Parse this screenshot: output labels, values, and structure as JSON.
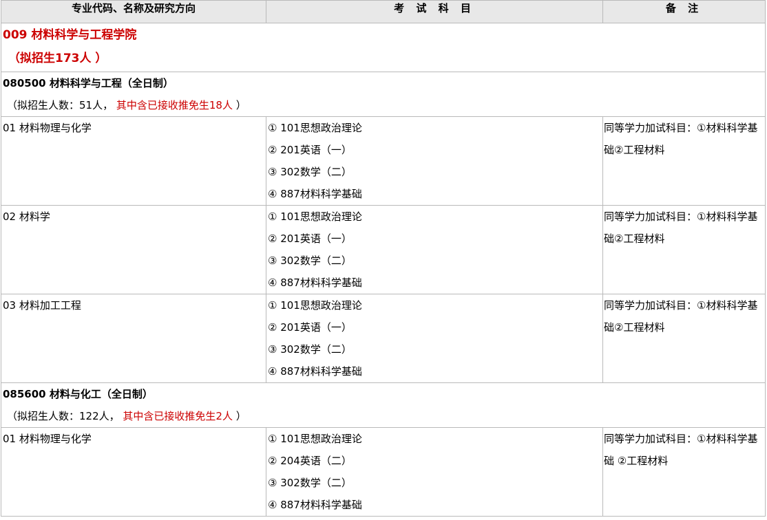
{
  "header": {
    "col1": "专业代码、名称及研究方向",
    "col2": "考 试 科 目",
    "col3": "备 注"
  },
  "school": {
    "name": "009 材料科学与工程学院",
    "quota": "（拟招生173人 ）"
  },
  "majors": [
    {
      "title": "080500 材料科学与工程（全日制）",
      "quota_prefix": "（拟招生人数：51人，",
      "quota_red": " 其中含已接收推免生18人",
      "quota_suffix": " ）",
      "directions": [
        {
          "name": "01 材料物理与化学",
          "subjects": [
            "① 101思想政治理论",
            "② 201英语（一）",
            "③ 302数学（二）",
            "④ 887材料科学基础"
          ],
          "note": "同等学力加试科目：①材料科学基础②工程材料"
        },
        {
          "name": "02 材料学",
          "subjects": [
            "① 101思想政治理论",
            "② 201英语（一）",
            "③ 302数学（二）",
            "④ 887材料科学基础"
          ],
          "note": "同等学力加试科目：①材料科学基础②工程材料"
        },
        {
          "name": "03 材料加工工程",
          "subjects": [
            "① 101思想政治理论",
            "② 201英语（一）",
            "③ 302数学（二）",
            "④ 887材料科学基础"
          ],
          "note": "同等学力加试科目：①材料科学基础②工程材料"
        }
      ]
    },
    {
      "title": "085600 材料与化工（全日制）",
      "quota_prefix": "（拟招生人数：122人，",
      "quota_red": " 其中含已接收推免生2人",
      "quota_suffix": " ）",
      "directions": [
        {
          "name": "01 材料物理与化学",
          "subjects": [
            "① 101思想政治理论",
            "② 204英语（二）",
            "③ 302数学（二）",
            "④ 887材料科学基础"
          ],
          "note": "同等学力加试科目：①材料科学基础 ②工程材料"
        }
      ]
    }
  ]
}
